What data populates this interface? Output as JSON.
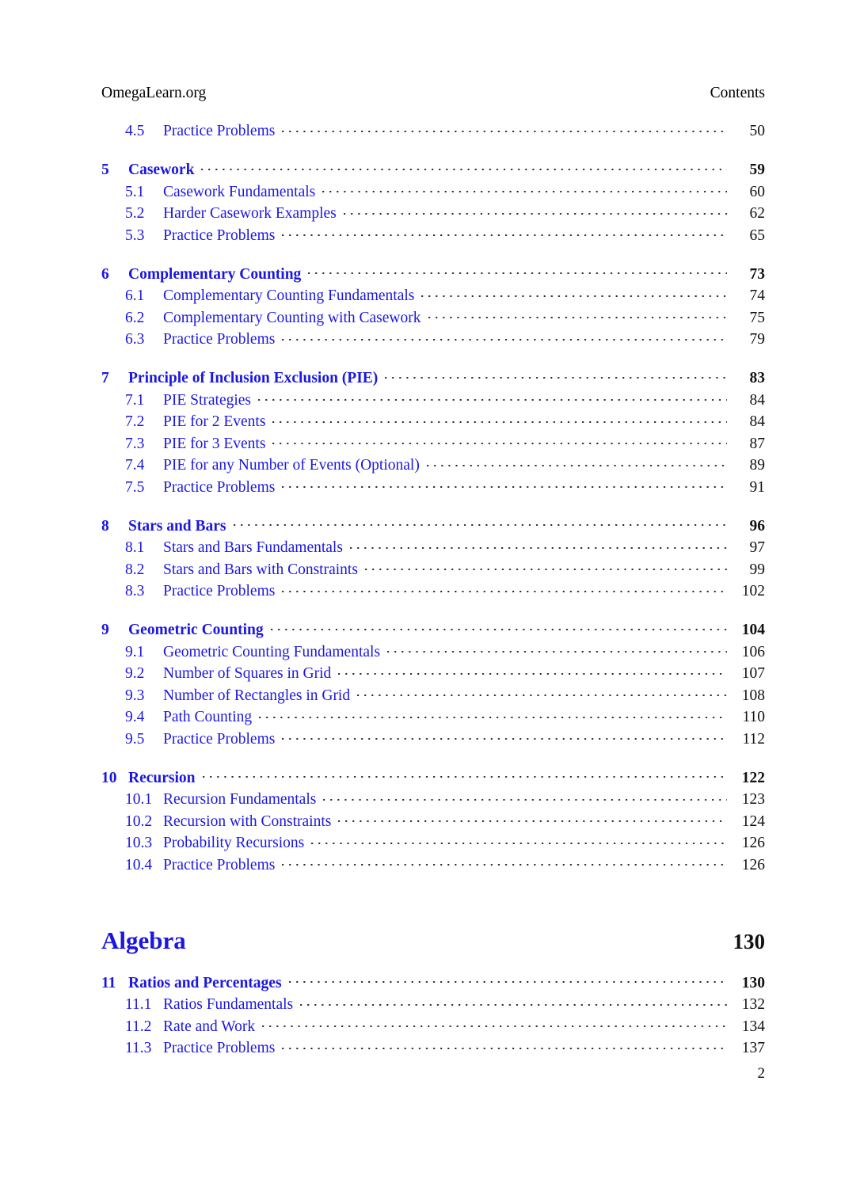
{
  "header": {
    "left": "OmegaLearn.org",
    "right": "Contents"
  },
  "footer": {
    "page_number": "2"
  },
  "colors": {
    "link_blue": "#1b17e0",
    "text_black": "#111111",
    "leader_dot": "#262626"
  },
  "toc": {
    "entries": [
      {
        "level": "section",
        "number": "4.5",
        "title": "Practice Problems",
        "page": "50",
        "first": true
      },
      {
        "level": "chapter",
        "number": "5",
        "title": "Casework",
        "page": "59"
      },
      {
        "level": "section",
        "number": "5.1",
        "title": "Casework Fundamentals",
        "page": "60"
      },
      {
        "level": "section",
        "number": "5.2",
        "title": "Harder Casework Examples",
        "page": "62"
      },
      {
        "level": "section",
        "number": "5.3",
        "title": "Practice Problems",
        "page": "65"
      },
      {
        "level": "chapter",
        "number": "6",
        "title": "Complementary Counting",
        "page": "73"
      },
      {
        "level": "section",
        "number": "6.1",
        "title": "Complementary Counting Fundamentals",
        "page": "74"
      },
      {
        "level": "section",
        "number": "6.2",
        "title": "Complementary Counting with Casework",
        "page": "75"
      },
      {
        "level": "section",
        "number": "6.3",
        "title": "Practice Problems",
        "page": "79"
      },
      {
        "level": "chapter",
        "number": "7",
        "title": "Principle of Inclusion Exclusion (PIE)",
        "page": "83"
      },
      {
        "level": "section",
        "number": "7.1",
        "title": "PIE Strategies",
        "page": "84"
      },
      {
        "level": "section",
        "number": "7.2",
        "title": "PIE for 2 Events",
        "page": "84"
      },
      {
        "level": "section",
        "number": "7.3",
        "title": "PIE for 3 Events",
        "page": "87"
      },
      {
        "level": "section",
        "number": "7.4",
        "title": "PIE for any Number of Events (Optional)",
        "page": "89"
      },
      {
        "level": "section",
        "number": "7.5",
        "title": "Practice Problems",
        "page": "91"
      },
      {
        "level": "chapter",
        "number": "8",
        "title": "Stars and Bars",
        "page": "96"
      },
      {
        "level": "section",
        "number": "8.1",
        "title": "Stars and Bars Fundamentals",
        "page": "97"
      },
      {
        "level": "section",
        "number": "8.2",
        "title": "Stars and Bars with Constraints",
        "page": "99"
      },
      {
        "level": "section",
        "number": "8.3",
        "title": "Practice Problems",
        "page": "102"
      },
      {
        "level": "chapter",
        "number": "9",
        "title": "Geometric Counting",
        "page": "104"
      },
      {
        "level": "section",
        "number": "9.1",
        "title": "Geometric Counting Fundamentals",
        "page": "106"
      },
      {
        "level": "section",
        "number": "9.2",
        "title": "Number of Squares in Grid",
        "page": "107"
      },
      {
        "level": "section",
        "number": "9.3",
        "title": "Number of Rectangles in Grid",
        "page": "108"
      },
      {
        "level": "section",
        "number": "9.4",
        "title": "Path Counting",
        "page": "110"
      },
      {
        "level": "section",
        "number": "9.5",
        "title": "Practice Problems",
        "page": "112"
      },
      {
        "level": "chapter",
        "number": "10",
        "title": "Recursion",
        "page": "122"
      },
      {
        "level": "section",
        "number": "10.1",
        "title": "Recursion Fundamentals",
        "page": "123"
      },
      {
        "level": "section",
        "number": "10.2",
        "title": "Recursion with Constraints",
        "page": "124"
      },
      {
        "level": "section",
        "number": "10.3",
        "title": "Probability Recursions",
        "page": "126"
      },
      {
        "level": "section",
        "number": "10.4",
        "title": "Practice Problems",
        "page": "126"
      },
      {
        "level": "part",
        "number": "",
        "title": "Algebra",
        "page": "130"
      },
      {
        "level": "chapter",
        "number": "11",
        "title": "Ratios and Percentages",
        "page": "130",
        "after_part": true
      },
      {
        "level": "section",
        "number": "11.1",
        "title": "Ratios Fundamentals",
        "page": "132"
      },
      {
        "level": "section",
        "number": "11.2",
        "title": "Rate and Work",
        "page": "134"
      },
      {
        "level": "section",
        "number": "11.3",
        "title": "Practice Problems",
        "page": "137"
      }
    ]
  }
}
